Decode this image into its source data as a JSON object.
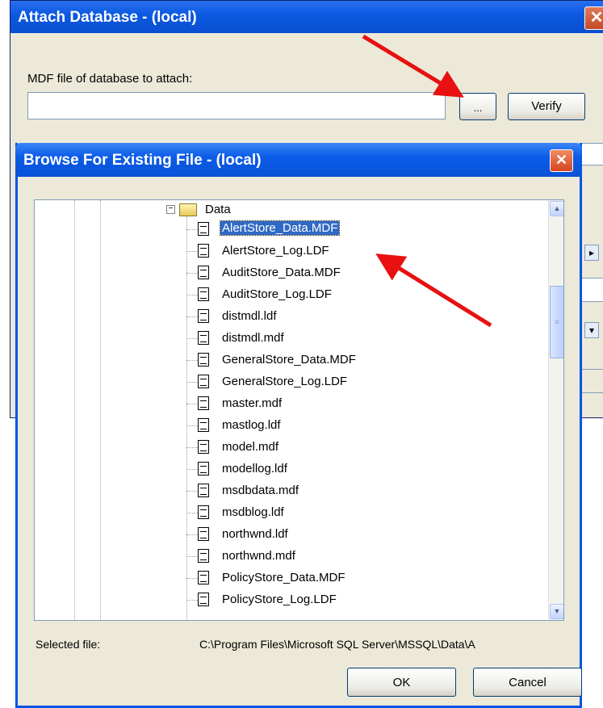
{
  "back_window": {
    "title": "Attach Database - (local)",
    "close_glyph": "✕",
    "mdf_label": "MDF file of database to attach:",
    "mdf_value": "",
    "browse_label": "...",
    "verify_label": "Verify"
  },
  "browse_dialog": {
    "title": "Browse For Existing File - (local)",
    "close_glyph": "✕",
    "folder": {
      "name": "Data",
      "expander": "−"
    },
    "files": [
      "AlertStore_Data.MDF",
      "AlertStore_Log.LDF",
      "AuditStore_Data.MDF",
      "AuditStore_Log.LDF",
      "distmdl.ldf",
      "distmdl.mdf",
      "GeneralStore_Data.MDF",
      "GeneralStore_Log.LDF",
      "master.mdf",
      "mastlog.ldf",
      "model.mdf",
      "modellog.ldf",
      "msdbdata.mdf",
      "msdblog.ldf",
      "northwnd.ldf",
      "northwnd.mdf",
      "PolicyStore_Data.MDF",
      "PolicyStore_Log.LDF"
    ],
    "selected_index": 0,
    "selected_file_label": "Selected file:",
    "selected_file_path": "C:\\Program Files\\Microsoft SQL Server\\MSSQL\\Data\\A",
    "ok_label": "OK",
    "cancel_label": "Cancel"
  },
  "colors": {
    "title_blue": "#0a58e0",
    "selection_blue": "#316ac5",
    "arrow_red": "#e81010"
  }
}
